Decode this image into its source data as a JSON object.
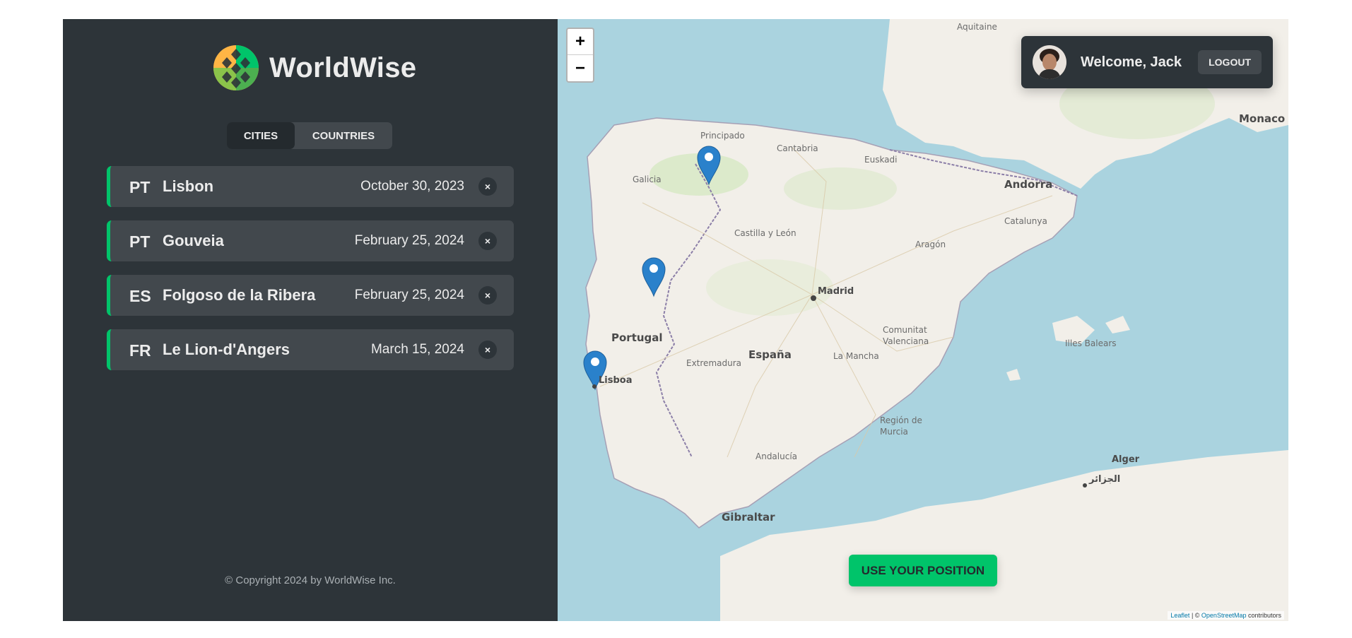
{
  "app": {
    "name": "WorldWise"
  },
  "tabs": [
    {
      "label": "CITIES"
    },
    {
      "label": "COUNTRIES"
    }
  ],
  "cities": [
    {
      "code": "PT",
      "name": "Lisbon",
      "date": "October 30, 2023",
      "delete": "×"
    },
    {
      "code": "PT",
      "name": "Gouveia",
      "date": "February 25, 2024",
      "delete": "×"
    },
    {
      "code": "ES",
      "name": "Folgoso de la Ribera",
      "date": "February 25, 2024",
      "delete": "×"
    },
    {
      "code": "FR",
      "name": "Le Lion-d'Angers",
      "date": "March 15, 2024",
      "delete": "×"
    }
  ],
  "footer": {
    "copyright": "© Copyright 2024 by WorldWise Inc."
  },
  "map": {
    "zoom_in": "+",
    "zoom_out": "−",
    "user": {
      "welcome": "Welcome, Jack",
      "logout": "LOGOUT"
    },
    "use_position": "USE YOUR POSITION",
    "attribution": {
      "leaflet": "Leaflet",
      "separator": " | © ",
      "osm": "OpenStreetMap",
      "suffix": " contributors"
    },
    "labels": {
      "aquitaine": "Aquitaine",
      "monaco": "Monaco",
      "andorra": "Andorra",
      "principado": "Principado",
      "galicia": "Galicia",
      "cantabria": "Cantabria",
      "euskadi": "Euskadi",
      "catalunya": "Catalunya",
      "aragon": "Aragón",
      "castilla": "Castilla y León",
      "madrid": "Madrid",
      "portugal": "Portugal",
      "espana": "España",
      "extremadura": "Extremadura",
      "lamancha": "La Mancha",
      "valenciana": "Comunitat Valenciana",
      "illes": "Illes Balears",
      "lisboa": "Lisboa",
      "murcia": "Región de Murcia",
      "andalucia": "Andalucía",
      "gibraltar": "Gibraltar",
      "alger": "Alger",
      "alger_ar": "الجزائر"
    },
    "colors": {
      "sea": "#aad3df",
      "land": "#f2efe9",
      "marker": "#2a81cb",
      "accent": "#00c46a"
    }
  }
}
